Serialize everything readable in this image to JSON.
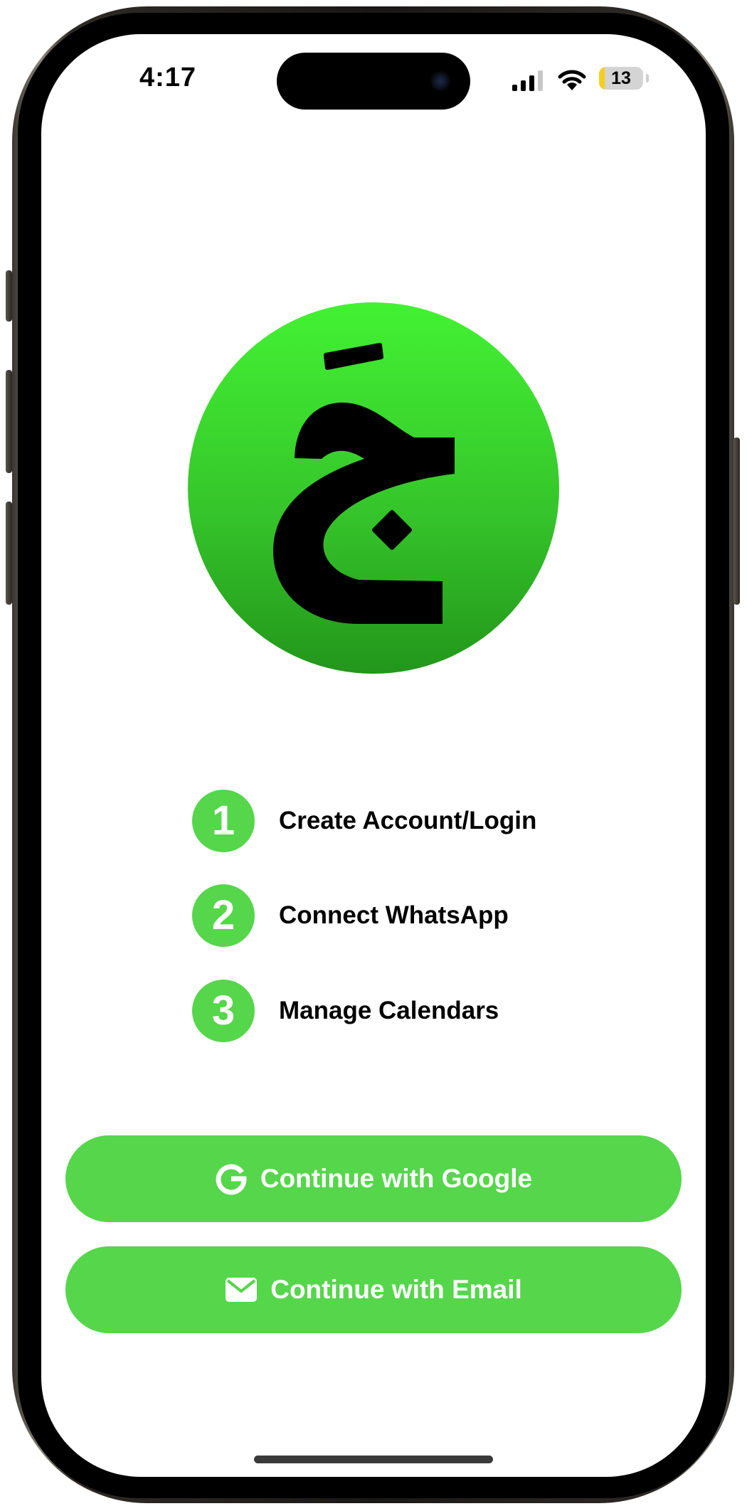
{
  "status_bar": {
    "time": "4:17",
    "battery_level": "13",
    "battery_fraction": 0.13
  },
  "logo": {
    "glyph": "جَ",
    "icon": "arabic-letter-jeem-logo"
  },
  "steps": [
    {
      "number": "1",
      "label": "Create Account/Login"
    },
    {
      "number": "2",
      "label": "Connect WhatsApp"
    },
    {
      "number": "3",
      "label": "Manage Calendars"
    }
  ],
  "buttons": {
    "google": {
      "label": "Continue with Google",
      "icon": "google-icon"
    },
    "email": {
      "label": "Continue with Email",
      "icon": "envelope-icon"
    }
  },
  "colors": {
    "accent": "#55d64b",
    "logo_top": "#43f233",
    "logo_bottom": "#23961b",
    "battery_low": "#f7ce1c"
  }
}
